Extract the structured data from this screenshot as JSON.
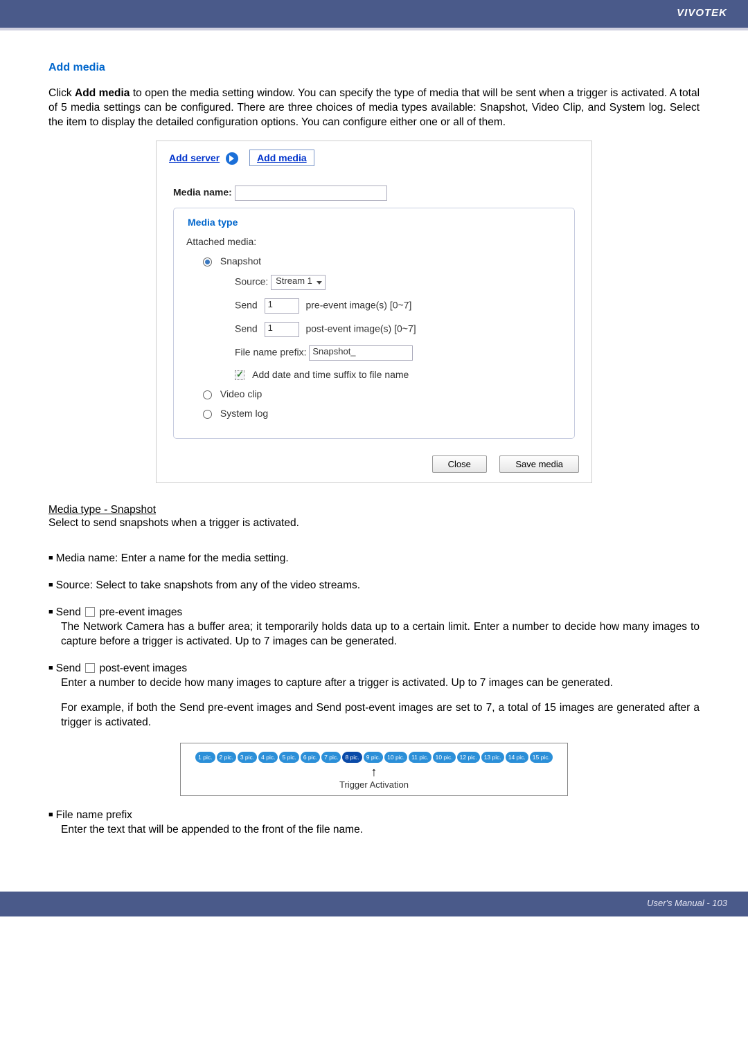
{
  "header": {
    "brand": "VIVOTEK"
  },
  "section": {
    "title": "Add media"
  },
  "intro": {
    "prefix": "Click ",
    "bold": "Add media",
    "rest": " to open the media setting window. You can specify the type of media that will be sent when a trigger is activated. A total of 5 media settings can be configured. There are three choices of media types available: Snapshot, Video Clip, and System log. Select the item to display the detailed configuration options. You can configure either one or all of them."
  },
  "dialog": {
    "add_server": "Add server",
    "add_media": "Add media",
    "media_name_label": "Media name:",
    "media_name_value": "",
    "fieldset_legend": "Media type",
    "attached_media": "Attached media:",
    "radio_snapshot": "Snapshot",
    "source_label": "Source:",
    "source_value": "Stream 1",
    "send_label": "Send",
    "pre_value": "1",
    "pre_suffix": "pre-event image(s) [0~7]",
    "post_value": "1",
    "post_suffix": "post-event image(s) [0~7]",
    "prefix_label": "File name prefix:",
    "prefix_value": "Snapshot_",
    "addsuffix_label": "Add date and time suffix to file name",
    "radio_video": "Video clip",
    "radio_syslog": "System log",
    "btn_close": "Close",
    "btn_save": "Save media"
  },
  "subheading": "Media type - Snapshot",
  "subtext": "Select to send snapshots when a trigger is activated.",
  "bullets": {
    "b1": "Media name: Enter a name for the media setting.",
    "b2": "Source: Select to take snapshots from any of the video streams.",
    "b3_lead": "Send ",
    "b3_tail": " pre-event images",
    "b3_sub": "The Network Camera has a buffer area; it temporarily holds data up to a certain limit. Enter a number to decide how many images to capture before a trigger is activated. Up to 7 images can be generated.",
    "b4_lead": "Send ",
    "b4_tail": " post-event images",
    "b4_sub1": "Enter a number to decide how many images to capture after a trigger is activated. Up to 7 images can be generated.",
    "b4_sub2": "For example, if both the Send pre-event images and Send post-event images are set to 7, a total of 15 images are generated after a trigger is activated.",
    "b5": "File name prefix",
    "b5_sub": "Enter the text that will be appended to the front of the file name."
  },
  "diagram": {
    "pills": [
      "1 pic.",
      "2 pic.",
      "3 pic.",
      "4 pic.",
      "5 pic.",
      "6 pic.",
      "7 pic.",
      "8 pic.",
      "9 pic.",
      "10 pic.",
      "11 pic.",
      "10 pic.",
      "12 pic.",
      "13 pic.",
      "14 pic.",
      "15 pic."
    ],
    "center_index": 7,
    "label": "Trigger Activation"
  },
  "footer": {
    "text": "User's Manual - 103"
  }
}
